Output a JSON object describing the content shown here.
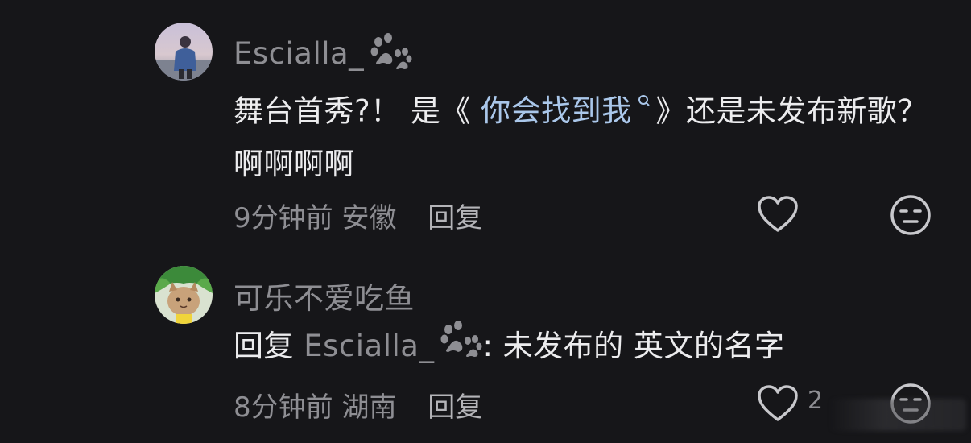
{
  "comments": [
    {
      "username": "Escialla_",
      "text_before": "舞台首秀?！ 是《 ",
      "link_text": "你会找到我",
      "text_after": " 》还是未发布新歌？ 啊啊啊啊",
      "time": "9分钟前",
      "location": "安徽",
      "reply_label": "回复"
    },
    {
      "username": "可乐不爱吃鱼",
      "reply_prefix": "回复",
      "reply_target": "Escialla_",
      "text": ": 未发布的 英文的名字",
      "time": "8分钟前",
      "location": "湖南",
      "reply_label": "回复",
      "like_count": "2"
    }
  ],
  "icons": {
    "like": "heart-outline-icon",
    "reaction": "dislike-face-icon",
    "badge": "paw-icon",
    "search_tag": "search-magnifier-icon"
  },
  "colors": {
    "background": "#161619",
    "link": "#aac7ea",
    "muted": "#8e8e93"
  }
}
